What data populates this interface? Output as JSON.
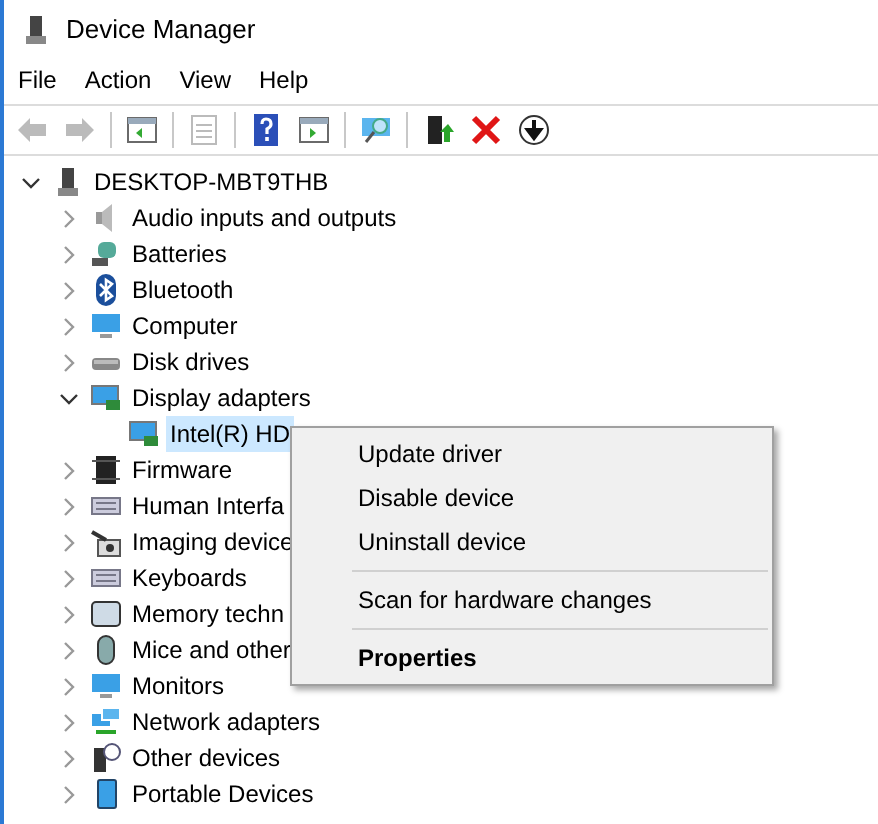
{
  "window": {
    "title": "Device Manager"
  },
  "menu_bar": [
    "File",
    "Action",
    "View",
    "Help"
  ],
  "toolbar": [
    {
      "kind": "back",
      "disabled": true
    },
    {
      "kind": "forward",
      "disabled": true
    },
    {
      "kind": "separator"
    },
    {
      "kind": "pane",
      "disabled": false
    },
    {
      "kind": "separator"
    },
    {
      "kind": "properties",
      "disabled": true
    },
    {
      "kind": "separator"
    },
    {
      "kind": "help",
      "disabled": false
    },
    {
      "kind": "run",
      "disabled": false
    },
    {
      "kind": "separator"
    },
    {
      "kind": "scan",
      "disabled": false
    },
    {
      "kind": "separator"
    },
    {
      "kind": "update",
      "disabled": false
    },
    {
      "kind": "uninstall",
      "disabled": false
    },
    {
      "kind": "download",
      "disabled": false
    }
  ],
  "tree": [
    {
      "label": "DESKTOP-MBT9THB",
      "kind": "computer-tower",
      "expanded": true,
      "selected": false,
      "children": [
        {
          "label": "Audio inputs and outputs",
          "kind": "speaker",
          "expanded": false,
          "selected": false
        },
        {
          "label": "Batteries",
          "kind": "battery",
          "expanded": false,
          "selected": false
        },
        {
          "label": "Bluetooth",
          "kind": "bluetooth",
          "expanded": false,
          "selected": false
        },
        {
          "label": "Computer",
          "kind": "monitor",
          "expanded": false,
          "selected": false
        },
        {
          "label": "Disk drives",
          "kind": "disk",
          "expanded": false,
          "selected": false
        },
        {
          "label": "Display adapters",
          "kind": "display",
          "expanded": true,
          "selected": false,
          "children": [
            {
              "label": "Intel(R) HD",
              "kind": "display",
              "selected": true
            }
          ]
        },
        {
          "label": "Firmware",
          "kind": "chip",
          "expanded": false,
          "selected": false
        },
        {
          "label": "Human Interfa",
          "kind": "keyboard",
          "expanded": false,
          "selected": false
        },
        {
          "label": "Imaging device",
          "kind": "camera",
          "expanded": false,
          "selected": false
        },
        {
          "label": "Keyboards",
          "kind": "keyboard",
          "expanded": false,
          "selected": false
        },
        {
          "label": "Memory techn",
          "kind": "memory",
          "expanded": false,
          "selected": false
        },
        {
          "label": "Mice and other",
          "kind": "mouse",
          "expanded": false,
          "selected": false
        },
        {
          "label": "Monitors",
          "kind": "monitor",
          "expanded": false,
          "selected": false
        },
        {
          "label": "Network adapters",
          "kind": "network",
          "expanded": false,
          "selected": false
        },
        {
          "label": "Other devices",
          "kind": "unknown",
          "expanded": false,
          "selected": false
        },
        {
          "label": "Portable Devices",
          "kind": "portable",
          "expanded": false,
          "selected": false
        }
      ]
    }
  ],
  "context_menu": [
    {
      "kind": "item",
      "label": "Update driver"
    },
    {
      "kind": "item",
      "label": "Disable device"
    },
    {
      "kind": "item",
      "label": "Uninstall device"
    },
    {
      "kind": "separator"
    },
    {
      "kind": "item",
      "label": "Scan for hardware changes"
    },
    {
      "kind": "separator"
    },
    {
      "kind": "default",
      "label": "Properties"
    }
  ]
}
